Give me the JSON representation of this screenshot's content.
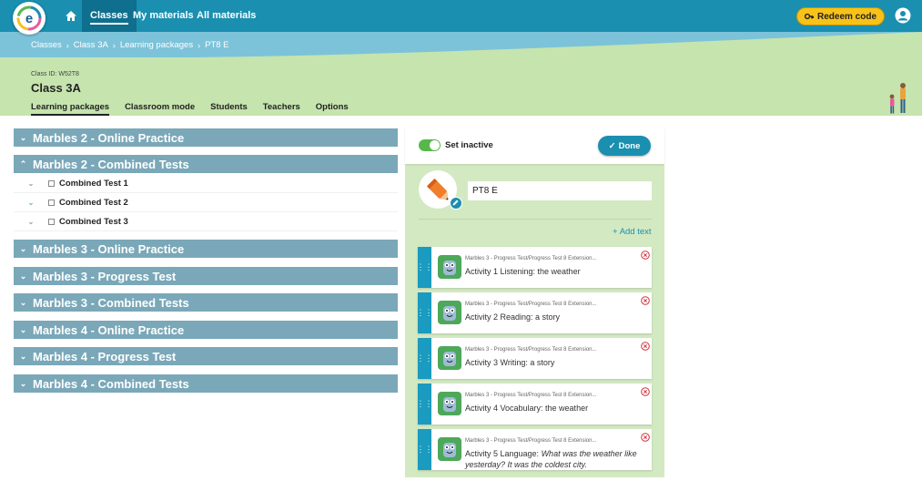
{
  "nav": {
    "items": [
      {
        "label": "Classes",
        "active": true
      },
      {
        "label": "My materials",
        "active": false
      },
      {
        "label": "All materials",
        "active": false
      }
    ],
    "redeem_label": "Redeem code"
  },
  "breadcrumb": [
    "Classes",
    "Class 3A",
    "Learning packages",
    "PT8 E"
  ],
  "class_header": {
    "class_id": "Class ID: W52T8",
    "class_name": "Class 3A",
    "tabs": [
      {
        "label": "Learning packages",
        "active": true
      },
      {
        "label": "Classroom mode",
        "active": false
      },
      {
        "label": "Students",
        "active": false
      },
      {
        "label": "Teachers",
        "active": false
      },
      {
        "label": "Options",
        "active": false
      }
    ]
  },
  "packages": [
    {
      "label": "Marbles 2 - Online Practice",
      "expanded": false
    },
    {
      "label": "Marbles 2 - Combined Tests",
      "expanded": true,
      "children": [
        "Combined Test 1",
        "Combined Test 2",
        "Combined Test 3"
      ]
    },
    {
      "label": "Marbles 3 - Online Practice",
      "expanded": false
    },
    {
      "label": "Marbles 3 - Progress Test",
      "expanded": false
    },
    {
      "label": "Marbles 3 - Combined Tests",
      "expanded": false
    },
    {
      "label": "Marbles 4 - Online Practice",
      "expanded": false
    },
    {
      "label": "Marbles 4 - Progress Test",
      "expanded": false
    },
    {
      "label": "Marbles 4 - Combined Tests",
      "expanded": false
    }
  ],
  "panel": {
    "set_inactive_label": "Set inactive",
    "done_label": "Done",
    "name_value": "PT8 E",
    "add_text_label": "Add text",
    "activities": [
      {
        "path": "Marbles 3 - Progress Test/Progress Test 8 Extension...",
        "title": "Activity 1 Listening: the weather",
        "title_italic": ""
      },
      {
        "path": "Marbles 3 - Progress Test/Progress Test 8 Extension...",
        "title": "Activity 2 Reading: a story",
        "title_italic": ""
      },
      {
        "path": "Marbles 3 - Progress Test/Progress Test 8 Extension...",
        "title": "Activity 3 Writing: a story",
        "title_italic": ""
      },
      {
        "path": "Marbles 3 - Progress Test/Progress Test 8 Extension...",
        "title": "Activity 4 Vocabulary: the weather",
        "title_italic": ""
      },
      {
        "path": "Marbles 3 - Progress Test/Progress Test 8 Extension...",
        "title": "Activity 5 Language: ",
        "title_italic": "What was the weather like yesterday? It was the coldest city."
      }
    ]
  },
  "colors": {
    "nav_bg": "#1a8fb0",
    "nav_active": "#0f6f8e",
    "breadcrumb_bg": "#7cc3da",
    "header_green": "#c6e4ae",
    "package_bar": "#7aa8b9",
    "panel_green": "#d3e9c2",
    "accent_yellow": "#f7c21a"
  }
}
